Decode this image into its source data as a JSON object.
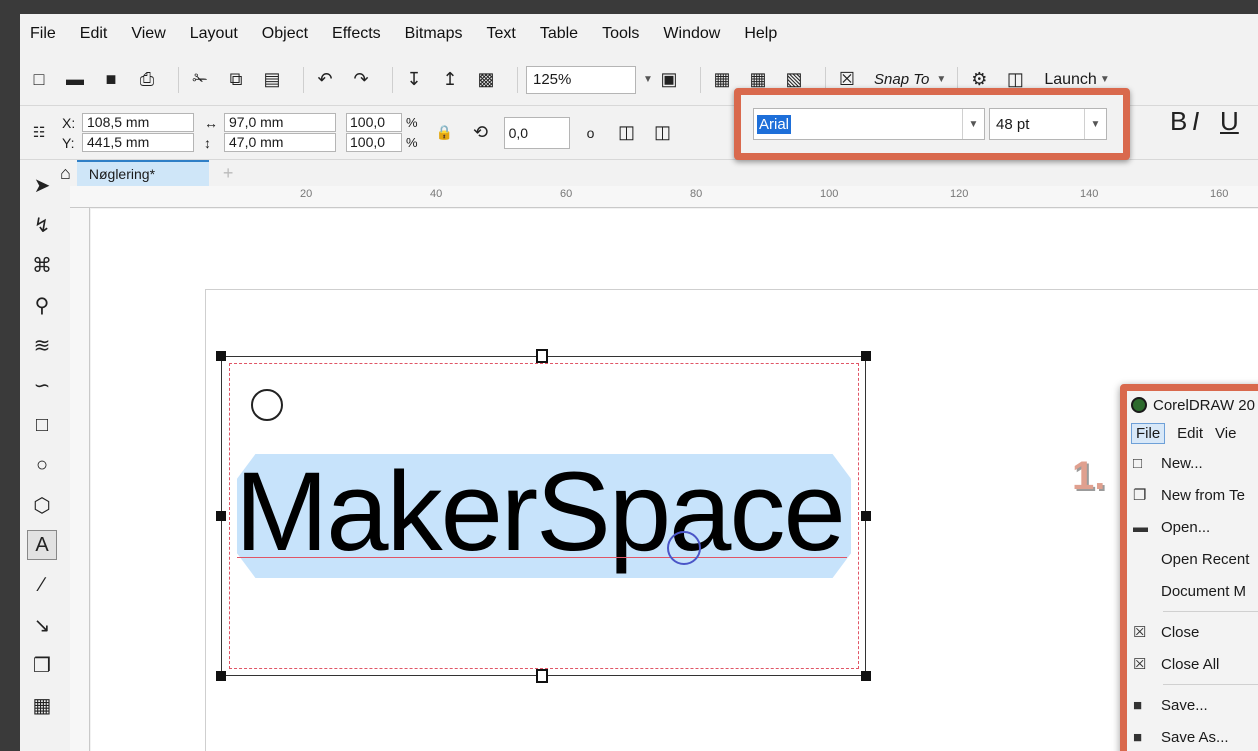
{
  "menu": [
    "File",
    "Edit",
    "View",
    "Layout",
    "Object",
    "Effects",
    "Bitmaps",
    "Text",
    "Table",
    "Tools",
    "Window",
    "Help"
  ],
  "toolbar": {
    "zoom": "125%",
    "snap_label": "Snap To",
    "launch_label": "Launch"
  },
  "propbar": {
    "x_label": "X:",
    "x_value": "108,5 mm",
    "y_label": "Y:",
    "y_value": "441,5 mm",
    "width": "97,0 mm",
    "height": "47,0 mm",
    "scale_x": "100,0",
    "scale_y": "100,0",
    "pct": "%",
    "rotation": "0,0",
    "degree_symbol": "o",
    "font_name": "Arial",
    "font_size": "48 pt",
    "bold": "B",
    "italic": "I",
    "underline": "U"
  },
  "tab": {
    "doc_name": "Nøglering*"
  },
  "ruler_labels": [
    "20",
    "40",
    "60",
    "80",
    "100",
    "120",
    "140",
    "160"
  ],
  "canvas": {
    "text": "MakerSpace"
  },
  "annotation": {
    "step": "1."
  },
  "file_menu": {
    "title": "CorelDRAW 20",
    "menubar": [
      "File",
      "Edit",
      "Vie"
    ],
    "items": [
      "New...",
      "New from Te",
      "Open...",
      "Open Recent",
      "Document M",
      "Close",
      "Close All",
      "Save...",
      "Save As..."
    ]
  },
  "colors": {
    "highlight_border": "#d9694d",
    "selection_fill": "#c7e3fb",
    "font_selection": "#1e6fd9"
  }
}
